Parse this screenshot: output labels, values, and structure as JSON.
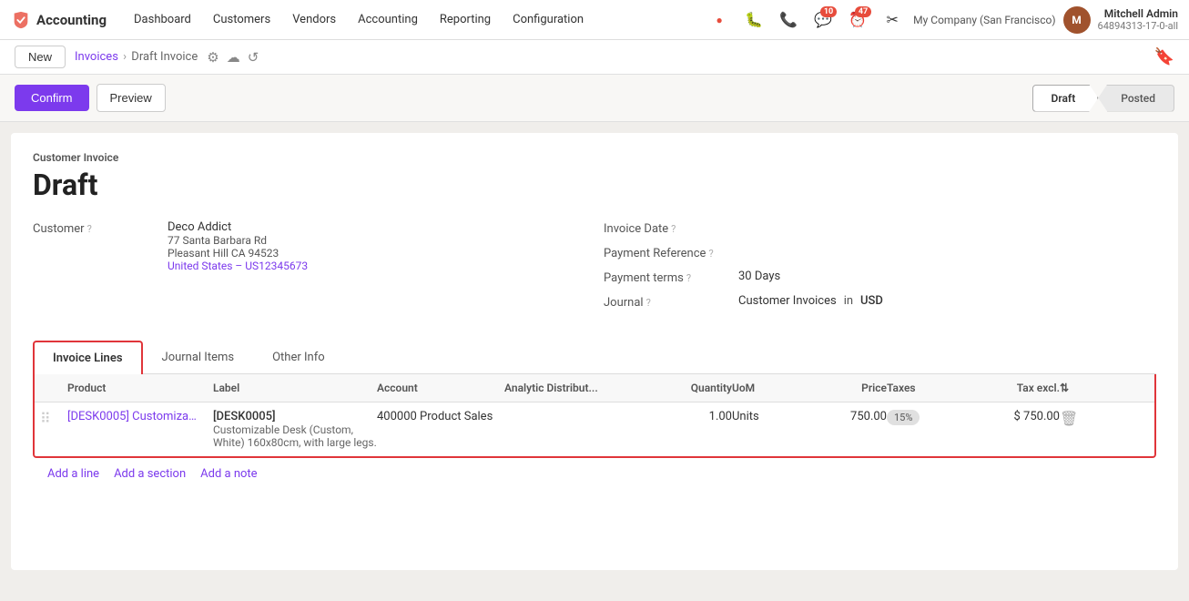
{
  "app": {
    "name": "Accounting",
    "logo_symbol": "✕"
  },
  "nav": {
    "items": [
      {
        "id": "dashboard",
        "label": "Dashboard",
        "active": false
      },
      {
        "id": "customers",
        "label": "Customers",
        "active": false
      },
      {
        "id": "vendors",
        "label": "Vendors",
        "active": false
      },
      {
        "id": "accounting",
        "label": "Accounting",
        "active": false
      },
      {
        "id": "reporting",
        "label": "Reporting",
        "active": false
      },
      {
        "id": "configuration",
        "label": "Configuration",
        "active": false
      }
    ],
    "icons": [
      {
        "id": "red-dot",
        "symbol": "●",
        "color": "#e74c3c",
        "badge": null
      },
      {
        "id": "bug",
        "symbol": "🐛",
        "badge": null
      },
      {
        "id": "phone",
        "symbol": "📞",
        "badge": null
      },
      {
        "id": "chat",
        "symbol": "💬",
        "badge": "10"
      },
      {
        "id": "clock",
        "symbol": "⏰",
        "badge": "47"
      },
      {
        "id": "wrench",
        "symbol": "✂",
        "badge": null
      }
    ],
    "company": "My Company (San Francisco)",
    "user": {
      "name": "Mitchell Admin",
      "code": "64894313-17-0-all"
    }
  },
  "breadcrumb": {
    "new_button_label": "New",
    "parent_label": "Invoices",
    "current_label": "Draft Invoice",
    "icons": [
      "⚙",
      "☁",
      "↺"
    ]
  },
  "actions": {
    "confirm_label": "Confirm",
    "preview_label": "Preview",
    "status_steps": [
      {
        "id": "draft",
        "label": "Draft",
        "active": true
      },
      {
        "id": "posted",
        "label": "Posted",
        "active": false
      }
    ]
  },
  "invoice": {
    "type_label": "Customer Invoice",
    "status_label": "Draft",
    "fields": {
      "customer": {
        "label": "Customer",
        "value": "Deco Addict",
        "address": [
          "77 Santa Barbara Rd",
          "Pleasant Hill CA 94523",
          "United States – US12345673"
        ]
      },
      "invoice_date": {
        "label": "Invoice Date",
        "value": ""
      },
      "payment_reference": {
        "label": "Payment Reference",
        "value": ""
      },
      "payment_terms": {
        "label": "Payment terms",
        "value": "30 Days"
      },
      "journal": {
        "label": "Journal",
        "value": "Customer Invoices",
        "currency_in": "in",
        "currency": "USD"
      }
    }
  },
  "tabs": [
    {
      "id": "invoice-lines",
      "label": "Invoice Lines",
      "active": true
    },
    {
      "id": "journal-items",
      "label": "Journal Items",
      "active": false
    },
    {
      "id": "other-info",
      "label": "Other Info",
      "active": false
    }
  ],
  "table": {
    "headers": [
      {
        "id": "drag",
        "label": ""
      },
      {
        "id": "product",
        "label": "Product"
      },
      {
        "id": "label",
        "label": "Label"
      },
      {
        "id": "account",
        "label": "Account"
      },
      {
        "id": "analytic",
        "label": "Analytic Distribut..."
      },
      {
        "id": "quantity",
        "label": "Quantity",
        "align": "right"
      },
      {
        "id": "uom",
        "label": "UoM"
      },
      {
        "id": "price",
        "label": "Price",
        "align": "right"
      },
      {
        "id": "taxes",
        "label": "Taxes"
      },
      {
        "id": "tax_excl",
        "label": "Tax excl.",
        "align": "right"
      },
      {
        "id": "actions",
        "label": "⇅"
      }
    ],
    "rows": [
      {
        "drag": "⠿",
        "product": "[DESK0005] Customiza…",
        "label_main": "[DESK0005]",
        "label_detail": "Customizable Desk (Custom, White) 160x80cm, with large legs.",
        "account": "400000 Product Sales",
        "analytic": "",
        "quantity": "1.00",
        "uom": "Units",
        "price": "750.00",
        "taxes": "15%",
        "tax_excl": "$ 750.00"
      }
    ]
  },
  "footer": {
    "add_line_label": "Add a line",
    "add_section_label": "Add a section",
    "add_note_label": "Add a note"
  }
}
